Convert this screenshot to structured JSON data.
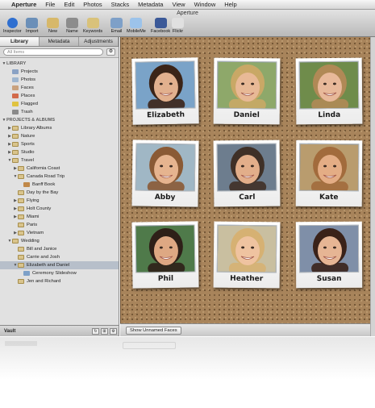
{
  "menubar": {
    "apple_icon": "apple-logo",
    "items": [
      "Aperture",
      "File",
      "Edit",
      "Photos",
      "Stacks",
      "Metadata",
      "View",
      "Window",
      "Help"
    ]
  },
  "window": {
    "title": "Aperture"
  },
  "toolbar": {
    "tools": [
      {
        "label": "Inspector",
        "icon": "inspector-icon",
        "color": "#2f6fd0"
      },
      {
        "label": "Import",
        "icon": "import-icon",
        "color": "#6b8fb8"
      },
      {
        "label": "New",
        "icon": "new-icon",
        "color": "#d7b86a"
      },
      {
        "label": "Name",
        "icon": "name-icon",
        "color": "#8c8c8c"
      },
      {
        "label": "Keywords",
        "icon": "keywords-icon",
        "color": "#d9c27a"
      },
      {
        "label": "Email",
        "icon": "email-icon",
        "color": "#7ea0c8"
      },
      {
        "label": "MobileMe",
        "icon": "mobileme-icon",
        "color": "#9cc3ea"
      },
      {
        "label": "Facebook",
        "icon": "facebook-icon",
        "color": "#3b5998"
      },
      {
        "label": "Flickr",
        "icon": "flickr-icon",
        "color": "#e0e0e0"
      }
    ]
  },
  "sidebar": {
    "tabs": [
      "Library",
      "Metadata",
      "Adjustments"
    ],
    "active_tab": "Library",
    "search_placeholder": "All Items",
    "gear_symbol": "⚙",
    "tree": [
      {
        "label": "LIBRARY",
        "type": "header",
        "level": 0,
        "expander": "open"
      },
      {
        "label": "Projects",
        "icon": "projects-icon",
        "level": 1
      },
      {
        "label": "Photos",
        "icon": "photos-icon",
        "level": 1
      },
      {
        "label": "Faces",
        "icon": "faces-icon",
        "level": 1
      },
      {
        "label": "Places",
        "icon": "places-icon",
        "level": 1
      },
      {
        "label": "Flagged",
        "icon": "flag-icon",
        "level": 1
      },
      {
        "label": "Trash",
        "icon": "trash-icon",
        "level": 1
      },
      {
        "label": "PROJECTS & ALBUMS",
        "type": "header",
        "level": 0,
        "expander": "open"
      },
      {
        "label": "Library Albums",
        "icon": "folder-icon",
        "level": 1,
        "expander": "closed"
      },
      {
        "label": "Nature",
        "icon": "folder-icon",
        "level": 1,
        "expander": "closed"
      },
      {
        "label": "Sports",
        "icon": "folder-icon",
        "level": 1,
        "expander": "closed"
      },
      {
        "label": "Studio",
        "icon": "folder-icon",
        "level": 1,
        "expander": "closed"
      },
      {
        "label": "Travel",
        "icon": "folder-icon",
        "level": 1,
        "expander": "open"
      },
      {
        "label": "California Coast",
        "icon": "project-icon",
        "level": 2,
        "expander": "closed"
      },
      {
        "label": "Canada Road Trip",
        "icon": "project-icon",
        "level": 2,
        "expander": "open"
      },
      {
        "label": "Banff Book",
        "icon": "book-icon",
        "level": 3
      },
      {
        "label": "Day by the Bay",
        "icon": "project-icon",
        "level": 2
      },
      {
        "label": "Flying",
        "icon": "project-icon",
        "level": 2,
        "expander": "closed"
      },
      {
        "label": "Holt County",
        "icon": "project-icon",
        "level": 2,
        "expander": "closed"
      },
      {
        "label": "Miami",
        "icon": "project-icon",
        "level": 2,
        "expander": "closed"
      },
      {
        "label": "Paris",
        "icon": "project-icon",
        "level": 2
      },
      {
        "label": "Vietnam",
        "icon": "project-icon",
        "level": 2,
        "expander": "closed"
      },
      {
        "label": "Wedding",
        "icon": "folder-icon",
        "level": 1,
        "expander": "open"
      },
      {
        "label": "Bill and Janice",
        "icon": "project-icon",
        "level": 2
      },
      {
        "label": "Carrie and Josh",
        "icon": "project-icon",
        "level": 2
      },
      {
        "label": "Elizabeth and Daniel",
        "icon": "project-icon",
        "level": 2,
        "expander": "open",
        "selected": true
      },
      {
        "label": "Ceremony Slideshow",
        "icon": "slideshow-icon",
        "level": 3
      },
      {
        "label": "Jen and Richard",
        "icon": "project-icon",
        "level": 2
      }
    ],
    "vault": {
      "label": "Vault"
    }
  },
  "faces": [
    {
      "name": "Elizabeth",
      "bg": "#7aa3c8",
      "skin": "#e2b08e",
      "hair": "#3b2418"
    },
    {
      "name": "Daniel",
      "bg": "#8ea86a",
      "skin": "#e8b996",
      "hair": "#c9a866"
    },
    {
      "name": "Linda",
      "bg": "#6f8c4b",
      "skin": "#e8b99a",
      "hair": "#b08956"
    },
    {
      "name": "Abby",
      "bg": "#a0b7c5",
      "skin": "#e6b48f",
      "hair": "#8a5a35"
    },
    {
      "name": "Carl",
      "bg": "#6d7d8e",
      "skin": "#e2ae8a",
      "hair": "#3f3027"
    },
    {
      "name": "Kate",
      "bg": "#b99c6e",
      "skin": "#e4ad85",
      "hair": "#a26b3c"
    },
    {
      "name": "Phil",
      "bg": "#4f7a4a",
      "skin": "#dea883",
      "hair": "#2e2018"
    },
    {
      "name": "Heather",
      "bg": "#c9bfa0",
      "skin": "#efc3a0",
      "hair": "#d6b173"
    },
    {
      "name": "Susan",
      "bg": "#7f8fa8",
      "skin": "#e6b594",
      "hair": "#3a2219"
    }
  ],
  "bottom_bar": {
    "button": "Show Unnamed Faces"
  }
}
